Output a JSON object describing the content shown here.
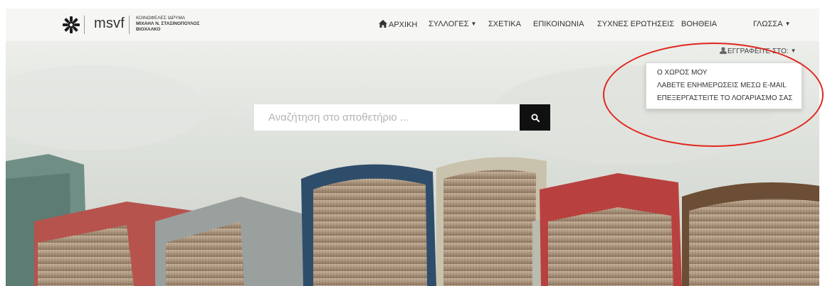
{
  "logo": {
    "icon": "gear-sun-icon",
    "word": "msvf",
    "org_line1": "ΚΟΙΝΩΦΕΛΕΣ ΙΔΡΥΜΑ",
    "org_line2": "ΜΙΧΑΗΛ Ν. ΣΤΑΣΙΝΟΠΟΥΛΟΣ",
    "org_line3": "ΒΙΟΧΑΛΚΟ"
  },
  "nav": {
    "home": "ΑΡΧΙΚΗ",
    "collections": "ΣΥΛΛΟΓΕΣ",
    "about": "ΣΧΕΤΙΚΑ",
    "contact": "ΕΠΙΚΟΙΝΩΝΙΑ",
    "faq": "ΣΥΧΝΕΣ ΕΡΩΤΗΣΕΙΣ",
    "help": "ΒΟΗΘΕΙΑ",
    "language": "ΓΛΩΣΣΑ"
  },
  "user_menu": {
    "toggle_label": "ΕΓΓΡΑΦΕΙΤΕ ΣΤΟ:",
    "items": [
      {
        "label": "Ο ΧΩΡΟΣ ΜΟΥ"
      },
      {
        "label": "ΛΑΒΕΤΕ ΕΝΗΜΕΡΩΣΕΙΣ ΜΕΣΩ E-MAIL"
      },
      {
        "label": "ΕΠΕΞΕΡΓΑΣΤΕΙΤΕ ΤΟ ΛΟΓΑΡΙΑΣΜΟ ΣΑΣ"
      }
    ]
  },
  "search": {
    "placeholder": "Αναζήτηση στο αποθετήριο ...",
    "value": ""
  },
  "colors": {
    "annotation_circle": "#e2261f",
    "search_button": "#101010"
  }
}
